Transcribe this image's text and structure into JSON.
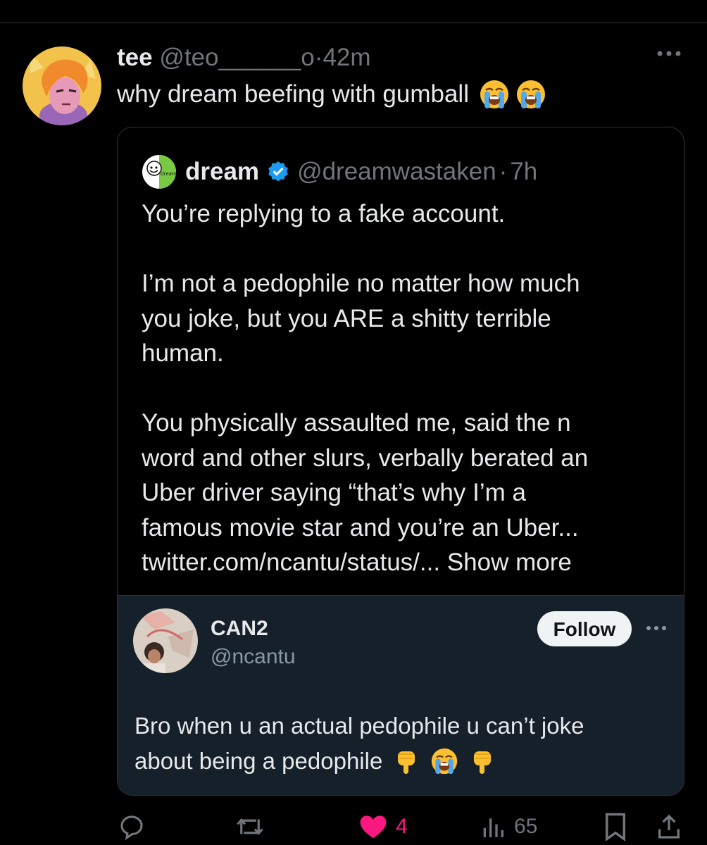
{
  "tweet": {
    "author_name": "tee",
    "author_handle": "@teo______o",
    "separator": "·",
    "time": "42m",
    "text": "why dream beefing with gumball",
    "emojis": [
      "loudly-crying-face",
      "loudly-crying-face"
    ]
  },
  "quoted": {
    "author_name": "dream",
    "author_handle": "@dreamwastaken",
    "separator": "·",
    "time": "7h",
    "verified": true,
    "avatar_logo_text": "dream",
    "body": {
      "line1": "You’re replying to a fake account.",
      "p2_line1": "I’m not a pedophile no matter how much",
      "p2_line2": "you joke, but you ARE a shitty terrible",
      "p2_line3": "human.",
      "p3_line1": "You physically assaulted me, said the n",
      "p3_line2": "word and other slurs, verbally berated an",
      "p3_line3": "Uber driver saying “that’s why I’m a",
      "p3_line4": "famous movie star and you’re an Uber...",
      "p3_line5_link": "twitter.com/ncantu/status/...",
      "show_more": "Show more"
    }
  },
  "embedded": {
    "author_name": "CAN2",
    "author_handle": "@ncantu",
    "follow_label": "Follow",
    "text_line1": "Bro when u an actual pedophile u can’t joke",
    "text_line2": "about being a pedophile",
    "emojis": [
      "backhand-index-pointing-down",
      "loudly-crying-face",
      "backhand-index-pointing-down"
    ]
  },
  "actions": {
    "likes": "4",
    "views": "65"
  },
  "colors": {
    "background": "#000000",
    "text": "#e7e9ea",
    "muted": "#71767b",
    "verified": "#1d9bf0",
    "like": "#f91880",
    "embedded_bg": "#15202b",
    "follow_bg": "#eff3f4"
  }
}
